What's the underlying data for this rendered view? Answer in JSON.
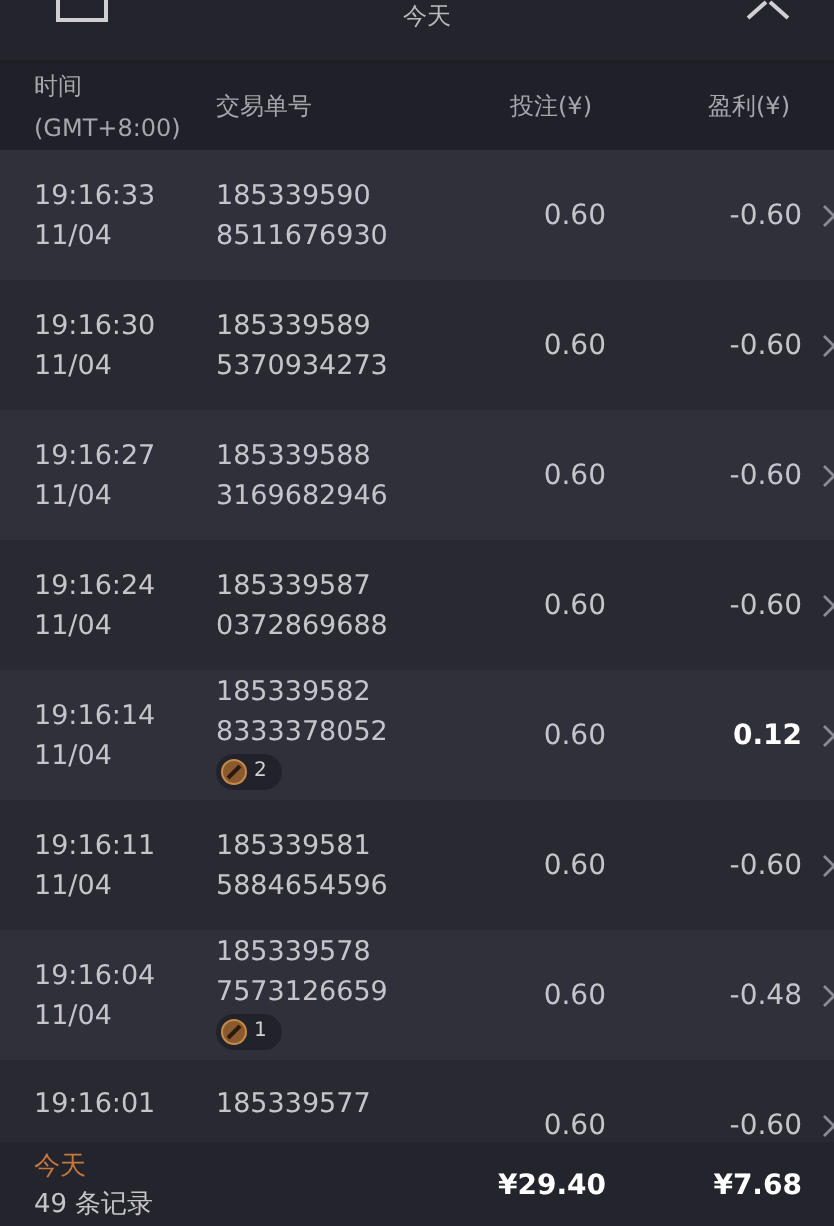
{
  "header": {
    "title": "今天"
  },
  "columns": [
    "时间\n(GMT+8:00)",
    "交易单号",
    "投注(¥)",
    "盈利(¥)"
  ],
  "rows": [
    {
      "time": "19:16:33",
      "date": "11/04",
      "id_1": "185339590",
      "id_2": "8511676930",
      "bet": "0.60",
      "profit": "-0.60",
      "highlight": false
    },
    {
      "time": "19:16:30",
      "date": "11/04",
      "id_1": "185339589",
      "id_2": "5370934273",
      "bet": "0.60",
      "profit": "-0.60",
      "highlight": false
    },
    {
      "time": "19:16:27",
      "date": "11/04",
      "id_1": "185339588",
      "id_2": "3169682946",
      "bet": "0.60",
      "profit": "-0.60",
      "highlight": false
    },
    {
      "time": "19:16:24",
      "date": "11/04",
      "id_1": "185339587",
      "id_2": "0372869688",
      "bet": "0.60",
      "profit": "-0.60",
      "highlight": false
    },
    {
      "time": "19:16:14",
      "date": "11/04",
      "id_1": "185339582",
      "id_2": "8333378052",
      "badge": "2",
      "bet": "0.60",
      "profit": "0.12",
      "highlight": true
    },
    {
      "time": "19:16:11",
      "date": "11/04",
      "id_1": "185339581",
      "id_2": "5884654596",
      "bet": "0.60",
      "profit": "-0.60",
      "highlight": false
    },
    {
      "time": "19:16:04",
      "date": "11/04",
      "id_1": "185339578",
      "id_2": "7573126659",
      "badge": "1",
      "bet": "0.60",
      "profit": "-0.48",
      "highlight": false
    },
    {
      "time": "19:16:01",
      "id_1": "185339577",
      "bet": "0.60",
      "profit": "-0.60",
      "highlight": false
    }
  ],
  "footer": {
    "label": "今天",
    "count": "49 条记录",
    "bet_total": "¥29.40",
    "profit_total": "¥7.68"
  }
}
